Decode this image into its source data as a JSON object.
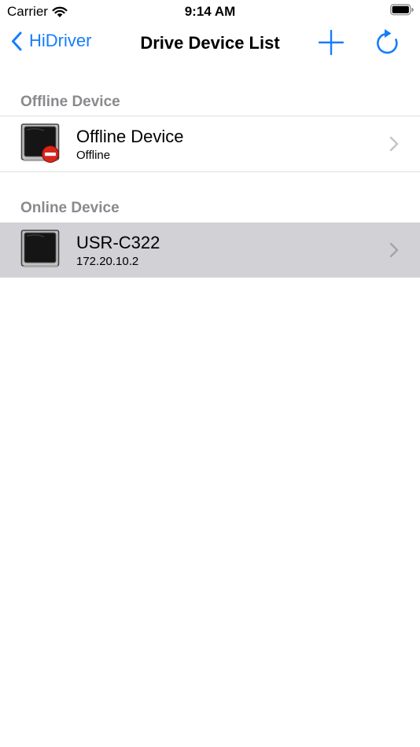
{
  "status_bar": {
    "carrier": "Carrier",
    "time": "9:14 AM"
  },
  "nav": {
    "back_label": "HiDriver",
    "title": "Drive Device List"
  },
  "sections": {
    "offline": {
      "header": "Offline Device",
      "item": {
        "title": "Offline Device",
        "subtitle": "Offline"
      }
    },
    "online": {
      "header": "Online Device",
      "item": {
        "title": "USR-C322",
        "subtitle": "172.20.10.2"
      }
    }
  },
  "icons": {
    "wifi": "wifi-icon",
    "battery": "battery-icon",
    "back": "chevron-left-icon",
    "add": "plus-icon",
    "refresh": "refresh-icon",
    "device": "monitor-device-icon",
    "offline_badge": "no-entry-icon",
    "disclosure": "chevron-right-icon"
  },
  "colors": {
    "accent": "#157efb",
    "section_header": "#8a8a8e",
    "selected_row": "#d1d1d6",
    "offline_badge": "#d9261c"
  }
}
